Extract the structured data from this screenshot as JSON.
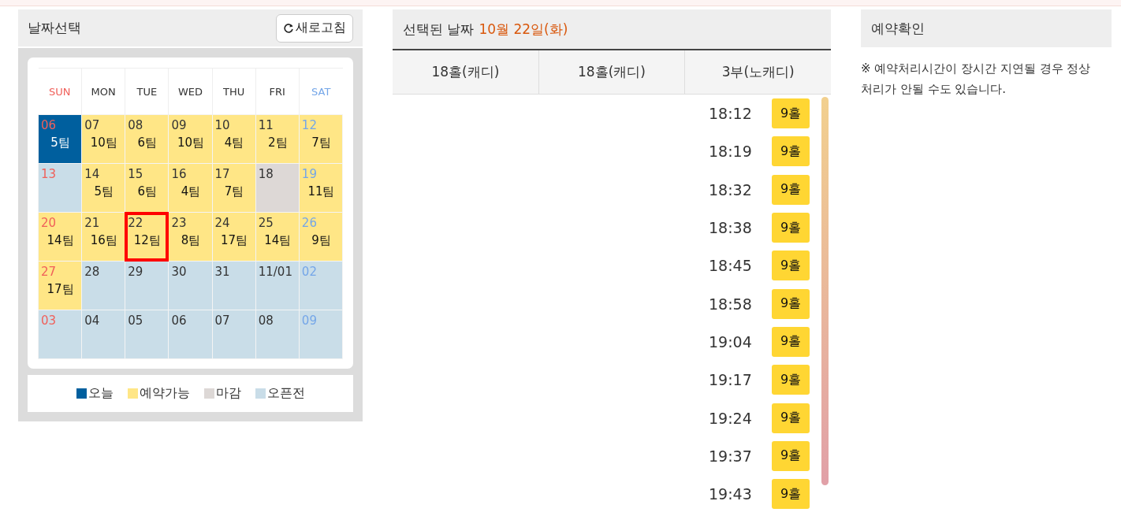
{
  "date_panel": {
    "title": "날짜선택",
    "refresh_button": "새로고침",
    "weekdays": [
      "SUN",
      "MON",
      "TUE",
      "WED",
      "THU",
      "FRI",
      "SAT"
    ],
    "weeks": [
      [
        {
          "day": "06",
          "teams": "5팀",
          "kind": "today",
          "selected": false
        },
        {
          "day": "07",
          "teams": "10팀",
          "kind": "available",
          "selected": false
        },
        {
          "day": "08",
          "teams": "6팀",
          "kind": "available",
          "selected": false
        },
        {
          "day": "09",
          "teams": "10팀",
          "kind": "available",
          "selected": false
        },
        {
          "day": "10",
          "teams": "4팀",
          "kind": "available",
          "selected": false
        },
        {
          "day": "11",
          "teams": "2팀",
          "kind": "available",
          "selected": false
        },
        {
          "day": "12",
          "teams": "7팀",
          "kind": "available",
          "selected": false
        }
      ],
      [
        {
          "day": "13",
          "kind": "before_open",
          "selected": false
        },
        {
          "day": "14",
          "teams": "5팀",
          "kind": "available",
          "selected": false
        },
        {
          "day": "15",
          "teams": "6팀",
          "kind": "available",
          "selected": false
        },
        {
          "day": "16",
          "teams": "4팀",
          "kind": "available",
          "selected": false
        },
        {
          "day": "17",
          "teams": "7팀",
          "kind": "available",
          "selected": false
        },
        {
          "day": "18",
          "kind": "closed",
          "selected": false
        },
        {
          "day": "19",
          "teams": "11팀",
          "kind": "available",
          "selected": false
        }
      ],
      [
        {
          "day": "20",
          "teams": "14팀",
          "kind": "available",
          "selected": false
        },
        {
          "day": "21",
          "teams": "16팀",
          "kind": "available",
          "selected": false
        },
        {
          "day": "22",
          "teams": "12팀",
          "kind": "available",
          "selected": true
        },
        {
          "day": "23",
          "teams": "8팀",
          "kind": "available",
          "selected": false
        },
        {
          "day": "24",
          "teams": "17팀",
          "kind": "available",
          "selected": false
        },
        {
          "day": "25",
          "teams": "14팀",
          "kind": "available",
          "selected": false
        },
        {
          "day": "26",
          "teams": "9팀",
          "kind": "available",
          "selected": false
        }
      ],
      [
        {
          "day": "27",
          "teams": "17팀",
          "kind": "available",
          "selected": false
        },
        {
          "day": "28",
          "kind": "before_open",
          "selected": false
        },
        {
          "day": "29",
          "kind": "before_open",
          "selected": false
        },
        {
          "day": "30",
          "kind": "before_open",
          "selected": false
        },
        {
          "day": "31",
          "kind": "before_open",
          "selected": false
        },
        {
          "day": "11/01",
          "kind": "before_open",
          "selected": false
        },
        {
          "day": "02",
          "kind": "before_open",
          "selected": false
        }
      ],
      [
        {
          "day": "03",
          "kind": "before_open",
          "selected": false
        },
        {
          "day": "04",
          "kind": "before_open",
          "selected": false
        },
        {
          "day": "05",
          "kind": "before_open",
          "selected": false
        },
        {
          "day": "06",
          "kind": "before_open",
          "selected": false
        },
        {
          "day": "07",
          "kind": "before_open",
          "selected": false
        },
        {
          "day": "08",
          "kind": "before_open",
          "selected": false
        },
        {
          "day": "09",
          "kind": "before_open",
          "selected": false
        }
      ]
    ],
    "legend": [
      {
        "label": "오늘",
        "kind": "today"
      },
      {
        "label": "예약가능",
        "kind": "available"
      },
      {
        "label": "마감",
        "kind": "closed"
      },
      {
        "label": "오픈전",
        "kind": "before_open"
      }
    ]
  },
  "times_panel": {
    "title": "선택된 날짜",
    "selected_date": "10월 22일(화)",
    "columns": [
      "18홀(캐디)",
      "18홀(캐디)",
      "3부(노캐디)"
    ],
    "slots": [
      {
        "time": "18:12",
        "holes": "9홀"
      },
      {
        "time": "18:19",
        "holes": "9홀"
      },
      {
        "time": "18:32",
        "holes": "9홀"
      },
      {
        "time": "18:38",
        "holes": "9홀"
      },
      {
        "time": "18:45",
        "holes": "9홀"
      },
      {
        "time": "18:58",
        "holes": "9홀"
      },
      {
        "time": "19:04",
        "holes": "9홀"
      },
      {
        "time": "19:17",
        "holes": "9홀"
      },
      {
        "time": "19:24",
        "holes": "9홀"
      },
      {
        "time": "19:37",
        "holes": "9홀"
      },
      {
        "time": "19:43",
        "holes": "9홀"
      }
    ]
  },
  "confirm_panel": {
    "title": "예약확인",
    "notice": "※ 예약처리시간이 장시간 지연될 경우 정상 처리가 안될 수도 있습니다."
  }
}
